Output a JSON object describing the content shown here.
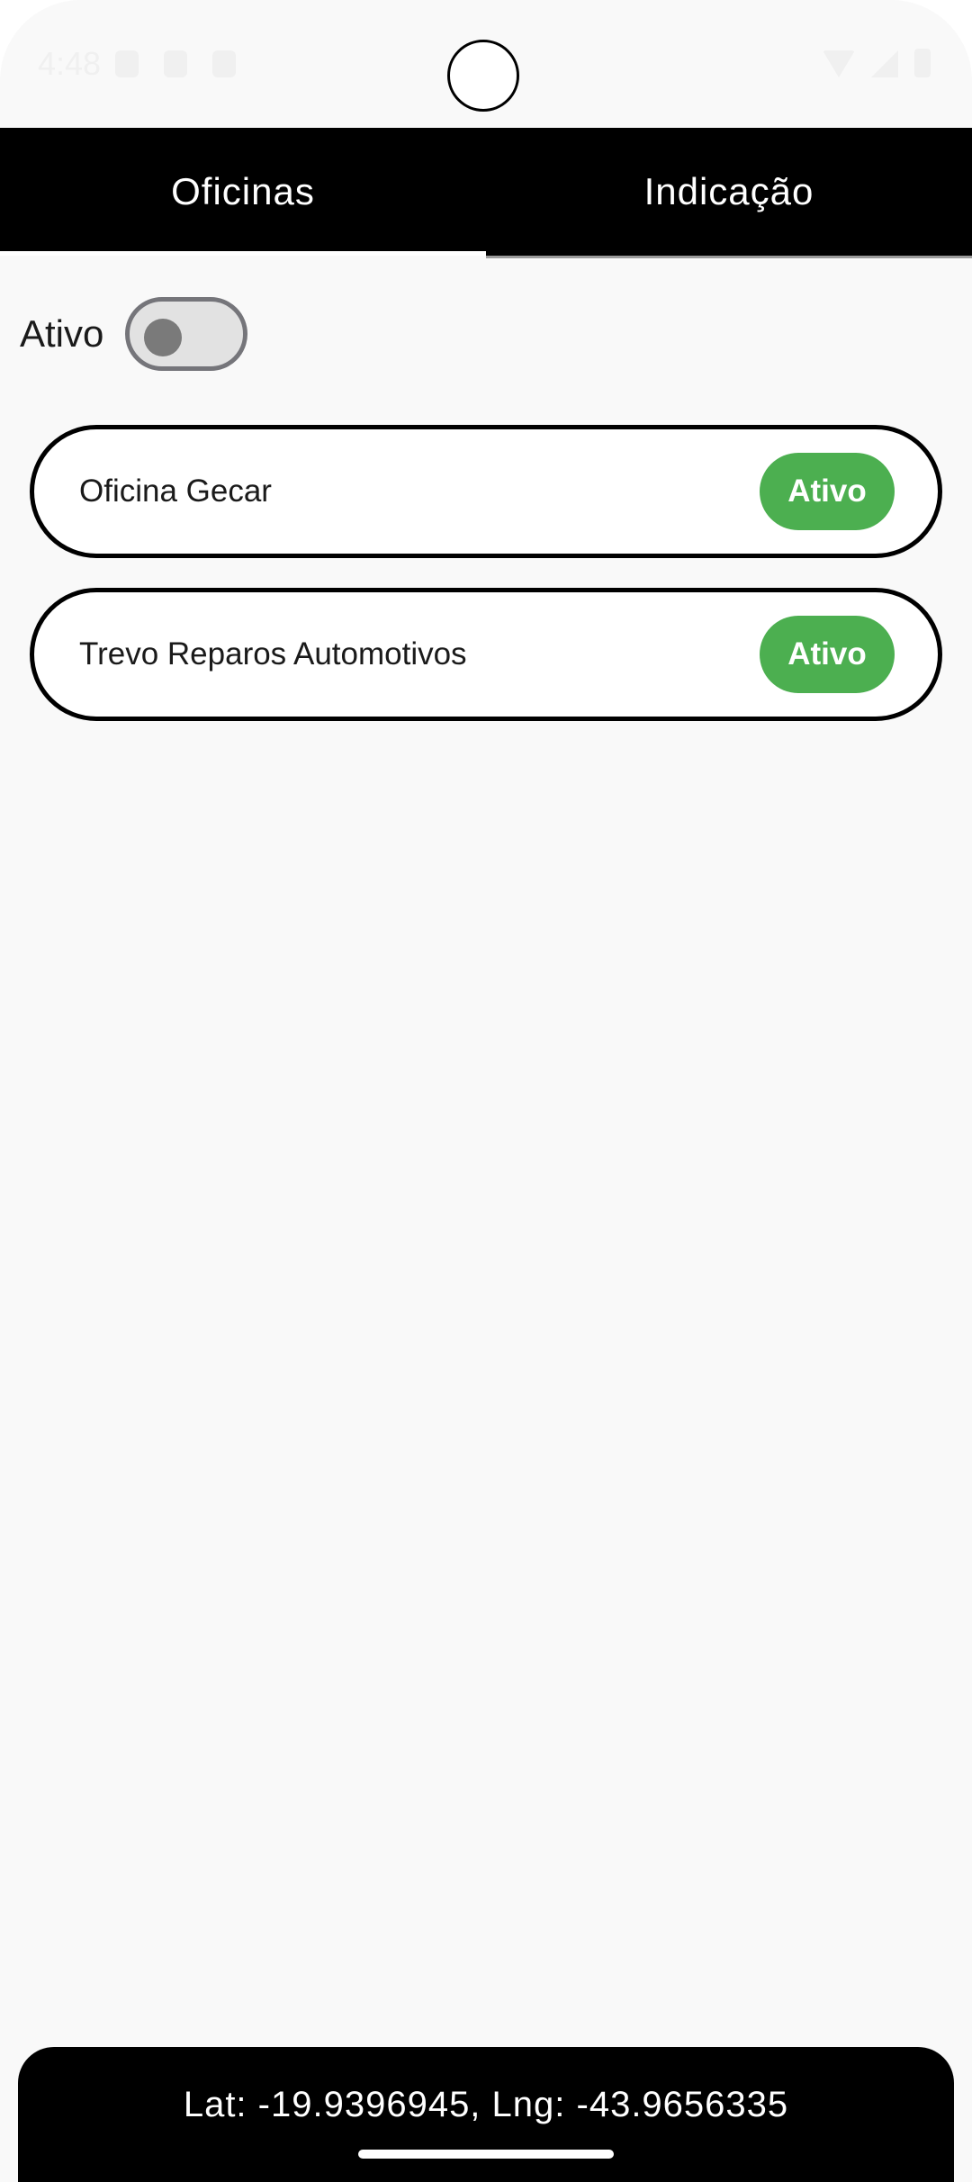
{
  "status_bar": {
    "time": "4:48"
  },
  "tabs": [
    {
      "label": "Oficinas",
      "selected": true
    },
    {
      "label": "Indicação",
      "selected": false
    }
  ],
  "filter": {
    "label": "Ativo",
    "toggle_on": false
  },
  "workshops": [
    {
      "name": "Oficina Gecar",
      "status": "Ativo"
    },
    {
      "name": "Trevo Reparos Automotivos",
      "status": "Ativo"
    }
  ],
  "location": {
    "text": "Lat: -19.9396945, Lng: -43.9656335"
  },
  "colors": {
    "primary": "#000000",
    "status_active": "#4caf50",
    "background": "#f9f9f9"
  }
}
